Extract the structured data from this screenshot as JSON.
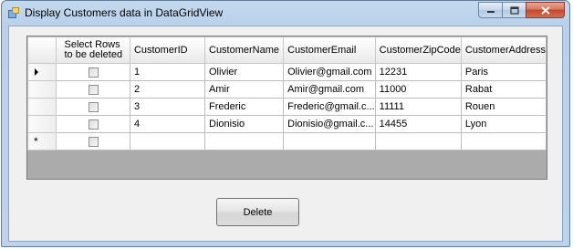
{
  "window": {
    "title": "Display Customers data in DataGridView",
    "icons": {
      "app": "form-icon",
      "minimize": "minimize-icon",
      "maximize": "maximize-icon",
      "close": "close-icon"
    }
  },
  "grid": {
    "columns": [
      "Select Rows to be deleted",
      "CustomerID",
      "CustomerName",
      "CustomerEmail",
      "CustomerZipCode",
      "CustomerAddress"
    ],
    "rows": [
      {
        "checked": false,
        "id": "1",
        "name": "Olivier",
        "email": "Olivier@gmail.com",
        "zip": "12231",
        "address": "Paris",
        "row_header": "current-row-arrow-icon"
      },
      {
        "checked": false,
        "id": "2",
        "name": "Amir",
        "email": "Amir@gmail.com",
        "zip": "11000",
        "address": "Rabat",
        "row_header": ""
      },
      {
        "checked": false,
        "id": "3",
        "name": "Frederic",
        "email": "Frederic@gmail.c...",
        "zip": "11111",
        "address": "Rouen",
        "row_header": ""
      },
      {
        "checked": false,
        "id": "4",
        "name": "Dionisio",
        "email": "Dionisio@gmail.c...",
        "zip": "14455",
        "address": "Lyon",
        "row_header": ""
      }
    ],
    "new_row_marker": "*"
  },
  "delete_button": {
    "label": "Delete"
  }
}
